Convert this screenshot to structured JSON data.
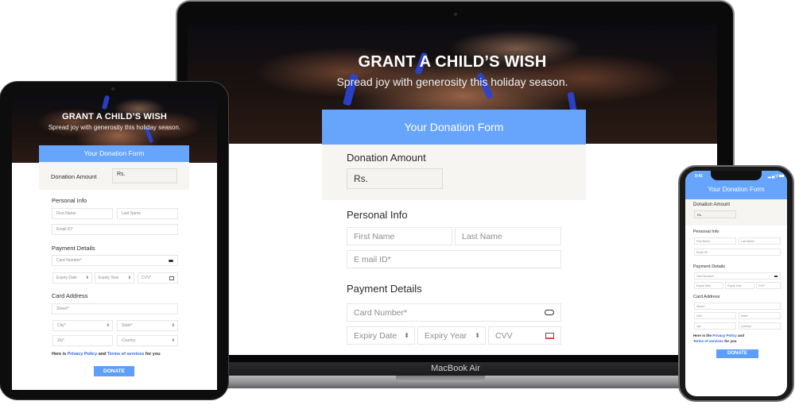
{
  "campaign": {
    "title": "GRANT A CHILD’S WISH",
    "subtitle": "Spread joy with generosity this holiday season."
  },
  "form": {
    "header": "Your Donation Form",
    "donation_amount_label": "Donation Amount",
    "donation_amount_value": "Rs.",
    "personal_info_label": "Personal Info",
    "first_name_placeholder": "First Name",
    "last_name_placeholder": "Last Name",
    "email_placeholder_laptop": "E mail ID*",
    "email_placeholder": "Email ID*",
    "payment_details_label": "Payment Details",
    "card_number_placeholder": "Card Number*",
    "expiry_date_placeholder": "Expiry Date",
    "expiry_year_placeholder": "Expiry Year",
    "cvv_placeholder_laptop": "CVV",
    "cvv_placeholder": "CVV*",
    "card_address_label": "Card Address",
    "street_placeholder": "Street*",
    "city_placeholder": "City*",
    "state_placeholder": "State*",
    "zip_placeholder": "Zip*",
    "country_placeholder_tablet": "Country",
    "country_placeholder_phone": "Country*",
    "terms_prefix_tablet": "Here is ",
    "terms_prefix_phone": "Here is the ",
    "privacy_link": "Privacy Policy",
    "and": " and ",
    "terms_link": "Terms of services",
    "terms_suffix": " for you",
    "donate_button": "DONATE"
  },
  "devices": {
    "laptop_label": "MacBook Air",
    "phone_time": "9:41",
    "phone_status_icons": "signal-wifi-battery"
  },
  "colors": {
    "accent": "#66a5fb",
    "button": "#5d9ff8",
    "link": "#2c66e6",
    "amount_section_bg": "#f6f5f2"
  }
}
